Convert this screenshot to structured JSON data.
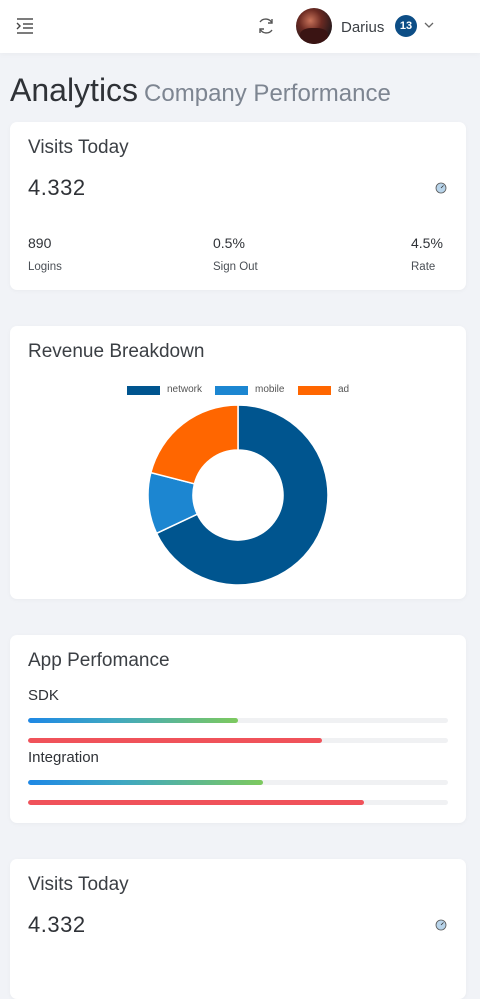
{
  "header": {
    "user_name": "Darius",
    "notification_count": "13"
  },
  "page": {
    "title": "Analytics",
    "subtitle": "Company Performance"
  },
  "visits_card": {
    "title": "Visits Today",
    "value": "4.332",
    "stats": [
      {
        "value": "890",
        "label": "Logins"
      },
      {
        "value": "0.5%",
        "label": "Sign Out"
      },
      {
        "value": "4.5%",
        "label": "Rate"
      }
    ]
  },
  "revenue_card": {
    "title": "Revenue Breakdown",
    "legend": [
      {
        "label": "network",
        "color": "#00558f"
      },
      {
        "label": "mobile",
        "color": "#1c86d1"
      },
      {
        "label": "ad",
        "color": "#ff6600"
      }
    ]
  },
  "chart_data": {
    "type": "pie",
    "donut": true,
    "categories": [
      "network",
      "mobile",
      "ad"
    ],
    "values": [
      68,
      11,
      21
    ],
    "colors": [
      "#00558f",
      "#1c86d1",
      "#ff6600"
    ],
    "legend_position": "top"
  },
  "performance_card": {
    "title": "App Perfomance",
    "groups": [
      {
        "label": "SDK",
        "bar1": 0.5,
        "bar2": 0.7
      },
      {
        "label": "Integration",
        "bar1": 0.56,
        "bar2": 0.8
      }
    ]
  },
  "visits_card_2": {
    "title": "Visits Today",
    "value": "4.332"
  }
}
